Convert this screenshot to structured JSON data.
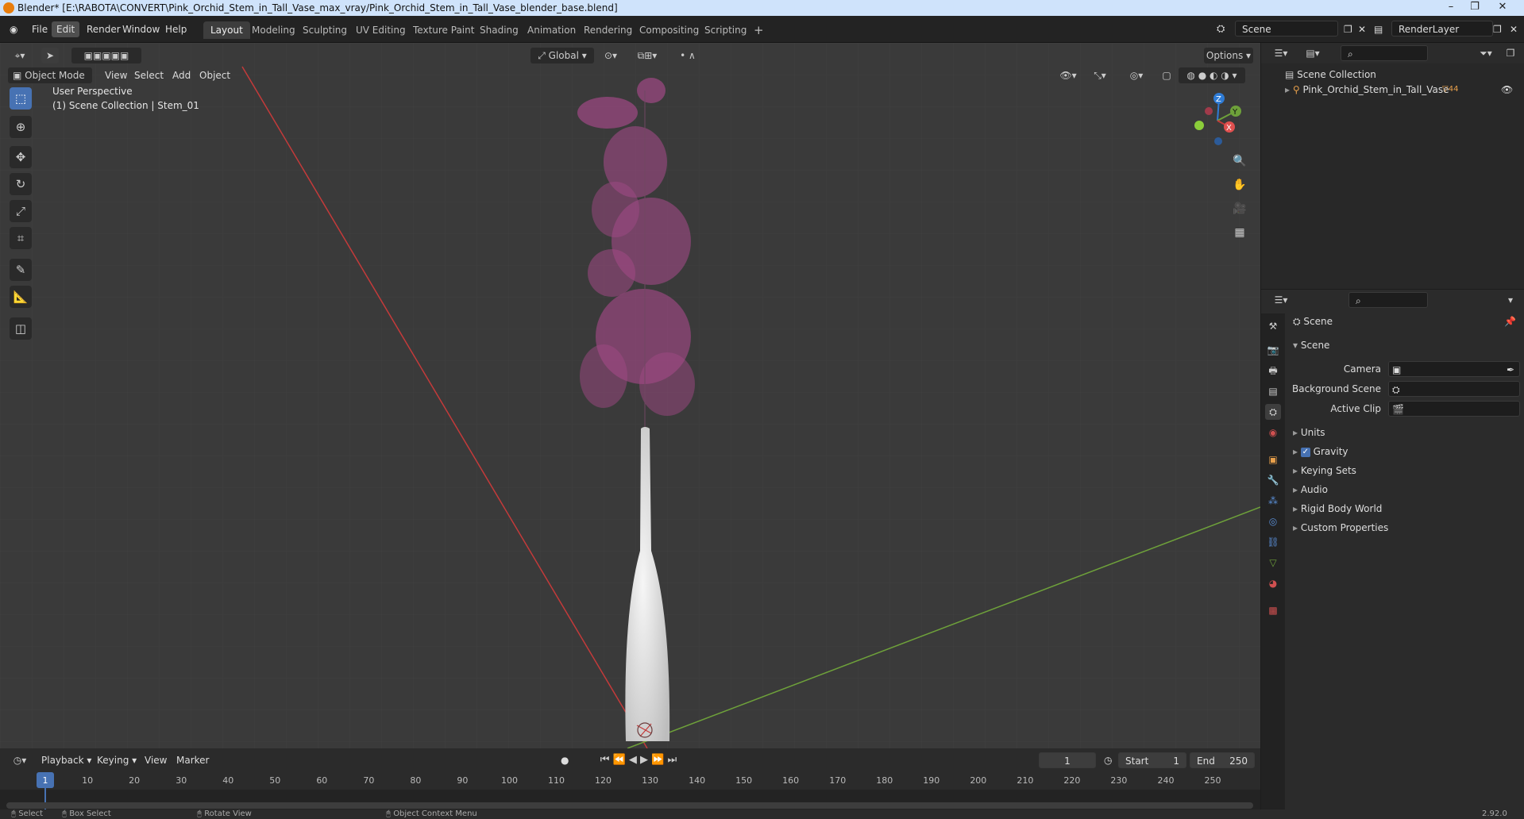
{
  "title": "Blender* [E:\\RABOTA\\CONVERT\\Pink_Orchid_Stem_in_Tall_Vase_max_vray/Pink_Orchid_Stem_in_Tall_Vase_blender_base.blend]",
  "menu": [
    "File",
    "Edit",
    "Render",
    "Window",
    "Help"
  ],
  "workspaces": [
    "Layout",
    "Modeling",
    "Sculpting",
    "UV Editing",
    "Texture Paint",
    "Shading",
    "Animation",
    "Rendering",
    "Compositing",
    "Scripting"
  ],
  "scene_field": "Scene",
  "render_layer": "RenderLayer",
  "viewport": {
    "mode": "Object Mode",
    "menus": [
      "View",
      "Select",
      "Add",
      "Object"
    ],
    "orientation": "Global",
    "options": "Options",
    "perspective": "User Perspective",
    "collection": "(1) Scene Collection | Stem_01",
    "gizmo": {
      "x": "X",
      "y": "Y",
      "z": "Z"
    }
  },
  "outliner": {
    "root": "Scene Collection",
    "items": [
      {
        "label": "Pink_Orchid_Stem_in_Tall_Vase",
        "count": "44"
      }
    ]
  },
  "properties": {
    "header": "Scene",
    "section": "Scene",
    "fields": [
      {
        "label": "Camera",
        "value": ""
      },
      {
        "label": "Background Scene",
        "value": ""
      },
      {
        "label": "Active Clip",
        "value": ""
      }
    ],
    "panels": [
      "Units",
      "Gravity",
      "Keying Sets",
      "Audio",
      "Rigid Body World",
      "Custom Properties"
    ],
    "gravity_checked": true
  },
  "timeline": {
    "menus": [
      "Playback",
      "Keying",
      "View",
      "Marker"
    ],
    "current_frame": "1",
    "start_label": "Start",
    "start": "1",
    "end_label": "End",
    "end": "250",
    "ticks": [
      "1",
      "10",
      "20",
      "30",
      "40",
      "50",
      "60",
      "70",
      "80",
      "90",
      "100",
      "110",
      "120",
      "130",
      "140",
      "150",
      "160",
      "170",
      "180",
      "190",
      "200",
      "210",
      "220",
      "230",
      "240",
      "250"
    ]
  },
  "status": {
    "items": [
      "Select",
      "Box Select",
      "Rotate View",
      "Object Context Menu"
    ],
    "version": "2.92.0"
  },
  "colors": {
    "accent": "#4772b3",
    "orchid": "#d05fa8",
    "x_axis": "#c43a3a",
    "y_axis": "#6ea13a"
  }
}
